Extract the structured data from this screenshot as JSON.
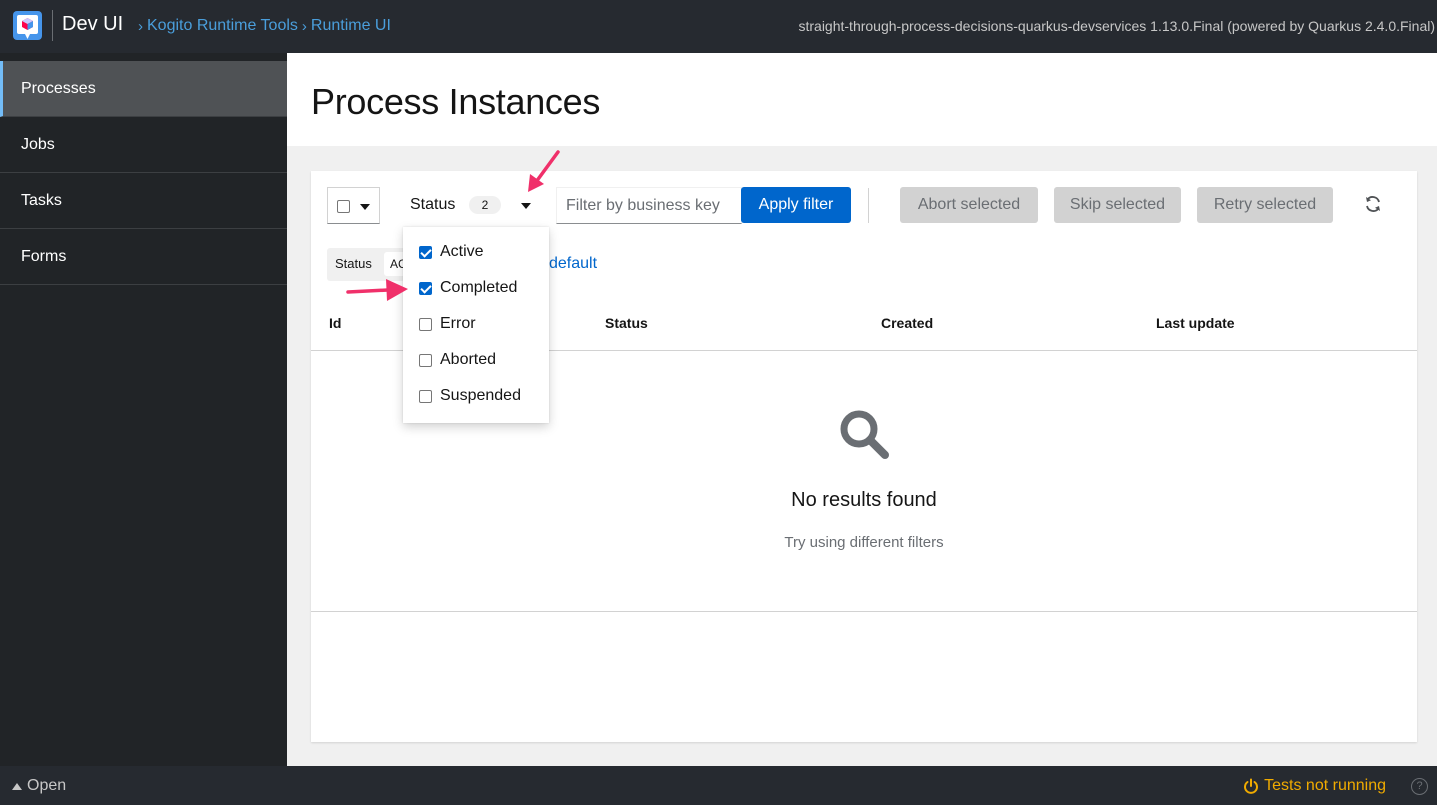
{
  "header": {
    "brand": "Dev UI",
    "breadcrumb": [
      "Kogito Runtime Tools",
      "Runtime UI"
    ],
    "app_info": "straight-through-process-decisions-quarkus-devservices 1.13.0.Final (powered by Quarkus 2.4.0.Final)"
  },
  "sidebar": {
    "items": [
      {
        "label": "Processes",
        "active": true
      },
      {
        "label": "Jobs"
      },
      {
        "label": "Tasks"
      },
      {
        "label": "Forms"
      }
    ]
  },
  "page": {
    "title": "Process Instances"
  },
  "toolbar": {
    "status_label": "Status",
    "status_count": "2",
    "filter_placeholder": "Filter by business key",
    "apply_label": "Apply filter",
    "abort_label": "Abort selected",
    "skip_label": "Skip selected",
    "retry_label": "Retry selected"
  },
  "chips": {
    "category": "Status",
    "first_chip": "ACTIVE",
    "reset_link": "default"
  },
  "status_menu": {
    "options": [
      {
        "label": "Active",
        "checked": true
      },
      {
        "label": "Completed",
        "checked": true
      },
      {
        "label": "Error",
        "checked": false
      },
      {
        "label": "Aborted",
        "checked": false
      },
      {
        "label": "Suspended",
        "checked": false
      }
    ]
  },
  "table": {
    "columns": [
      "Id",
      "Status",
      "Created",
      "Last update"
    ]
  },
  "empty_state": {
    "title": "No results found",
    "body": "Try using different filters"
  },
  "footer": {
    "open_label": "Open",
    "tests_label": "Tests not running"
  },
  "colors": {
    "accent": "#0066cc",
    "annotation_arrow": "#f0306a",
    "tests_warning": "#f0ab00"
  }
}
